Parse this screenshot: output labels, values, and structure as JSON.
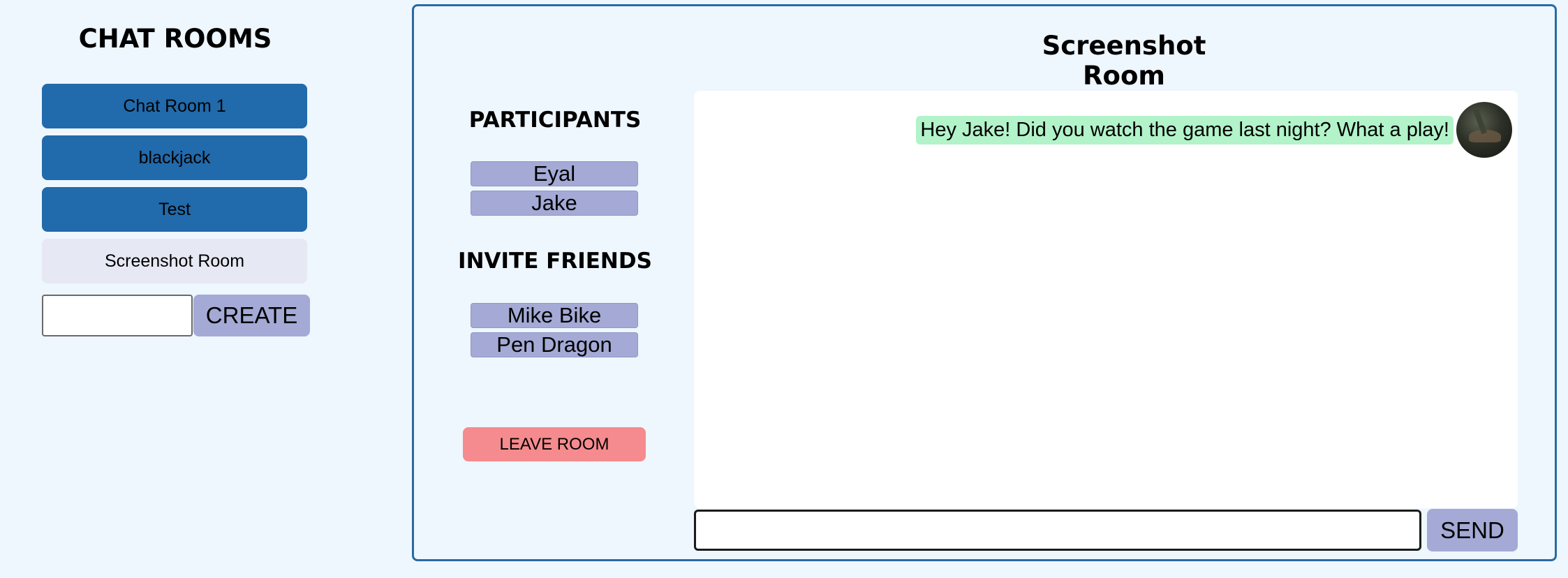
{
  "sidebar": {
    "title": "CHAT ROOMS",
    "rooms": [
      {
        "label": "Chat Room 1",
        "active": false
      },
      {
        "label": "blackjack",
        "active": false
      },
      {
        "label": "Test",
        "active": false
      },
      {
        "label": "Screenshot Room",
        "active": true
      }
    ],
    "create_input": {
      "value": "",
      "placeholder": ""
    },
    "create_label": "CREATE"
  },
  "room": {
    "title": "Screenshot Room",
    "participants_title": "PARTICIPANTS",
    "participants": [
      "Eyal",
      "Jake"
    ],
    "invite_title": "INVITE FRIENDS",
    "friends": [
      "Mike Bike",
      "Pen Dragon"
    ],
    "leave_label": "LEAVE ROOM"
  },
  "chat": {
    "messages": [
      {
        "text": "Hey Jake! Did you watch the game last night? What a play!",
        "avatar": "user-avatar"
      }
    ],
    "input": {
      "value": "",
      "placeholder": ""
    },
    "send_label": "SEND"
  },
  "colors": {
    "page_background": "#eef6fe",
    "room_button": "#216aab",
    "active_room_button": "#e6e8f4",
    "accent_button": "#a4aad5",
    "leave_button": "#f58b8e",
    "message_bubble": "#b2f3c9",
    "panel_border": "#2a6aa3"
  }
}
